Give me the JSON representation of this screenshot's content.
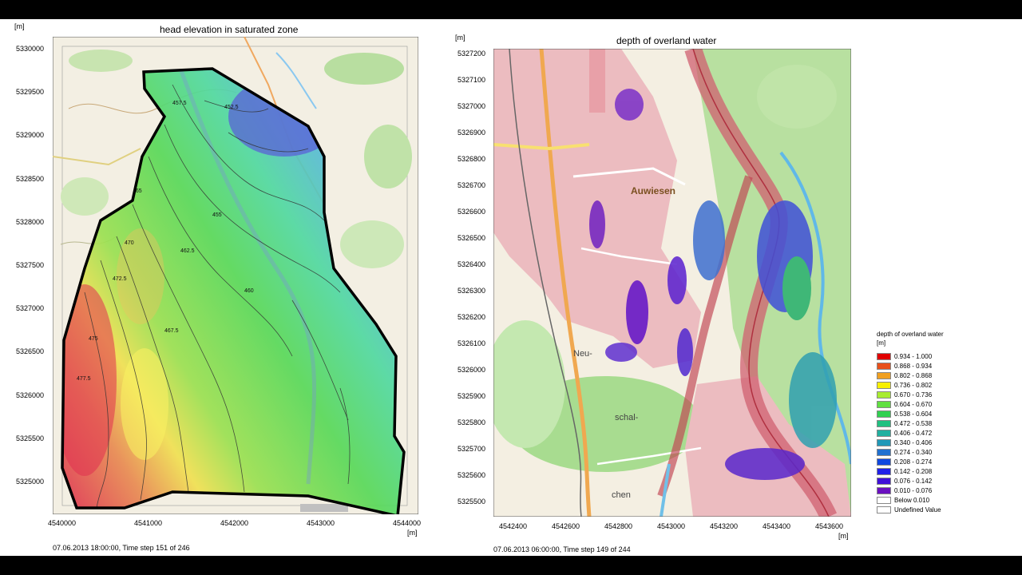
{
  "left_map": {
    "title": "head elevation in saturated zone",
    "y_unit": "[m]",
    "x_unit": "[m]",
    "y_ticks": [
      "5330000",
      "5329500",
      "5329000",
      "5328500",
      "5328000",
      "5327500",
      "5327000",
      "5326500",
      "5326000",
      "5325500",
      "5325000"
    ],
    "x_ticks": [
      "4540000",
      "4541000",
      "4542000",
      "4543000",
      "4544000"
    ],
    "status": "07.06.2013 18:00:00, Time step 151 of 246",
    "contour_labels": [
      "457.5",
      "452.5",
      "455",
      "465",
      "470",
      "472.5",
      "467.5",
      "460",
      "462.5",
      "475",
      "477.5"
    ]
  },
  "right_map": {
    "title": "depth of overland water",
    "y_unit": "[m]",
    "x_unit": "[m]",
    "y_ticks": [
      "5327200",
      "5327100",
      "5327000",
      "5326900",
      "5326800",
      "5326700",
      "5326600",
      "5326500",
      "5326400",
      "5326300",
      "5326200",
      "5326100",
      "5326000",
      "5325900",
      "5325800",
      "5325700",
      "5325600",
      "5325500"
    ],
    "x_ticks": [
      "4542400",
      "4542600",
      "4542800",
      "4543000",
      "4543200",
      "4543400",
      "4543600"
    ],
    "status": "07.06.2013 06:00:00, Time step 149 of 244",
    "place_labels": [
      "Auwiesen",
      "Neu-",
      "schal-",
      "chen"
    ]
  },
  "legend": {
    "title": "depth of overland water",
    "unit": "[m]",
    "entries": [
      {
        "label": "0.934 - 1.000",
        "color": "#e00000"
      },
      {
        "label": "0.868 - 0.934",
        "color": "#e8501a"
      },
      {
        "label": "0.802 - 0.868",
        "color": "#f0a020"
      },
      {
        "label": "0.736 - 0.802",
        "color": "#f8f000"
      },
      {
        "label": "0.670 - 0.736",
        "color": "#a8ec30"
      },
      {
        "label": "0.604 - 0.670",
        "color": "#60e040"
      },
      {
        "label": "0.538 - 0.604",
        "color": "#30d050"
      },
      {
        "label": "0.472 - 0.538",
        "color": "#20c080"
      },
      {
        "label": "0.406 - 0.472",
        "color": "#20b0a0"
      },
      {
        "label": "0.340 - 0.406",
        "color": "#2098b8"
      },
      {
        "label": "0.274 - 0.340",
        "color": "#2070d0"
      },
      {
        "label": "0.208 - 0.274",
        "color": "#1048e0"
      },
      {
        "label": "0.142 - 0.208",
        "color": "#2020e8"
      },
      {
        "label": "0.076 - 0.142",
        "color": "#4010d8"
      },
      {
        "label": "0.010 - 0.076",
        "color": "#6a10c0"
      },
      {
        "label": "Below  0.010",
        "color": "#ffffff"
      },
      {
        "label": "Undefined Value",
        "color": "#ffffff"
      }
    ]
  }
}
